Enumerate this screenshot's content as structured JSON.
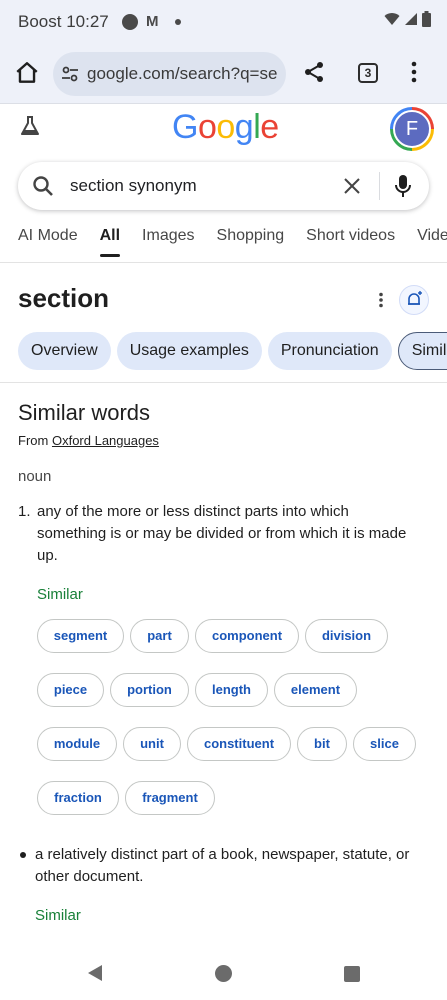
{
  "status": {
    "carrier": "Boost",
    "time": "10:27"
  },
  "browser": {
    "url": "google.com/search?q=se",
    "tab_count": "3"
  },
  "google": {
    "logo_letters": [
      {
        "ch": "G",
        "color": "#4285f4"
      },
      {
        "ch": "o",
        "color": "#ea4335"
      },
      {
        "ch": "o",
        "color": "#fbbc05"
      },
      {
        "ch": "g",
        "color": "#4285f4"
      },
      {
        "ch": "l",
        "color": "#34a853"
      },
      {
        "ch": "e",
        "color": "#ea4335"
      }
    ],
    "avatar_letter": "F"
  },
  "search": {
    "query": "section synonym"
  },
  "tabs": [
    "AI Mode",
    "All",
    "Images",
    "Shopping",
    "Short videos",
    "Videos"
  ],
  "active_tab": "All",
  "word": "section",
  "chips": [
    "Overview",
    "Usage examples",
    "Pronunciation",
    "Similar"
  ],
  "dictionary": {
    "title": "Similar words",
    "source_prefix": "From",
    "source_link": "Oxford Languages",
    "pos": "noun",
    "def1_num": "1.",
    "def1": "any of the more or less distinct parts into which something is or may be divided or from which it is made up.",
    "similar_label": "Similar",
    "synonym_rows": [
      [
        "segment",
        "part",
        "component",
        "division"
      ],
      [
        "piece",
        "portion",
        "length",
        "element"
      ],
      [
        "module",
        "unit",
        "constituent",
        "bit",
        "slice"
      ],
      [
        "fraction",
        "fragment"
      ]
    ],
    "def2": "a relatively distinct part of a book, newspaper, statute, or other document.",
    "similar_label_2": "Similar"
  }
}
